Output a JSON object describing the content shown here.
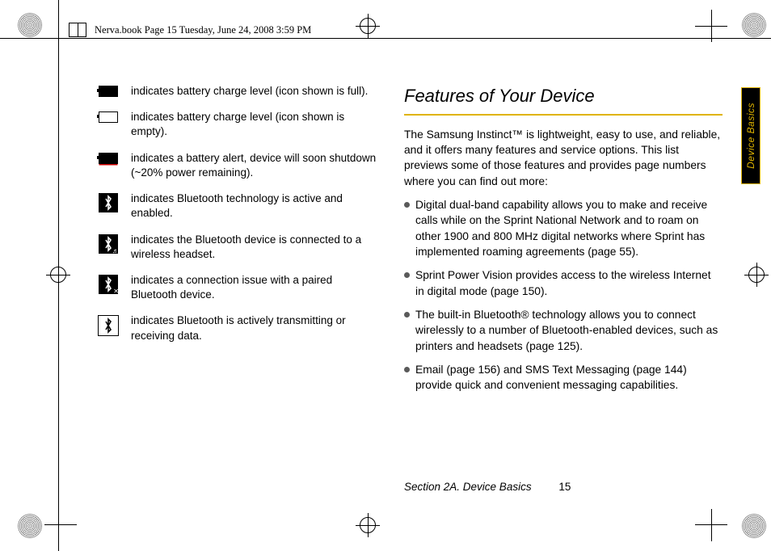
{
  "header": {
    "framemaker_line": "Nerva.book  Page 15  Tuesday, June 24, 2008  3:59 PM"
  },
  "left_items": [
    {
      "icon": "battery-full",
      "text": "indicates battery charge level (icon shown is full)."
    },
    {
      "icon": "battery-empty",
      "text": "indicates battery charge level (icon shown is empty)."
    },
    {
      "icon": "battery-alert",
      "text": "indicates a battery alert, device will soon shutdown (~20% power remaining)."
    },
    {
      "icon": "bluetooth-enabled",
      "text": "indicates Bluetooth technology is active and enabled."
    },
    {
      "icon": "bluetooth-headset",
      "text": "indicates the Bluetooth device is connected to a wireless headset."
    },
    {
      "icon": "bluetooth-issue",
      "text": "indicates a connection issue with a paired Bluetooth device."
    },
    {
      "icon": "bluetooth-data",
      "text": "indicates Bluetooth is actively transmitting or receiving data."
    }
  ],
  "right": {
    "title": "Features of Your Device",
    "intro": "The Samsung Instinct™ is lightweight, easy to use, and reliable, and it offers many features and service options. This list previews some of those features and provides page numbers where you can find out more:",
    "bullets": [
      "Digital dual-band capability allows you to make and receive calls while on the Sprint National Network and to roam on other 1900 and 800 MHz digital networks where Sprint has implemented roaming agreements (page 55).",
      "Sprint Power Vision provides access to the wireless Internet in digital mode (page 150).",
      "The built-in Bluetooth® technology allows you to connect wirelessly to a number of Bluetooth-enabled devices, such as printers and headsets (page 125).",
      "Email (page 156) and SMS Text Messaging (page 144) provide quick and convenient messaging capabilities."
    ]
  },
  "footer": {
    "section_label": "Section 2A. Device Basics",
    "page_number": "15"
  },
  "side_tab": "Device Basics"
}
